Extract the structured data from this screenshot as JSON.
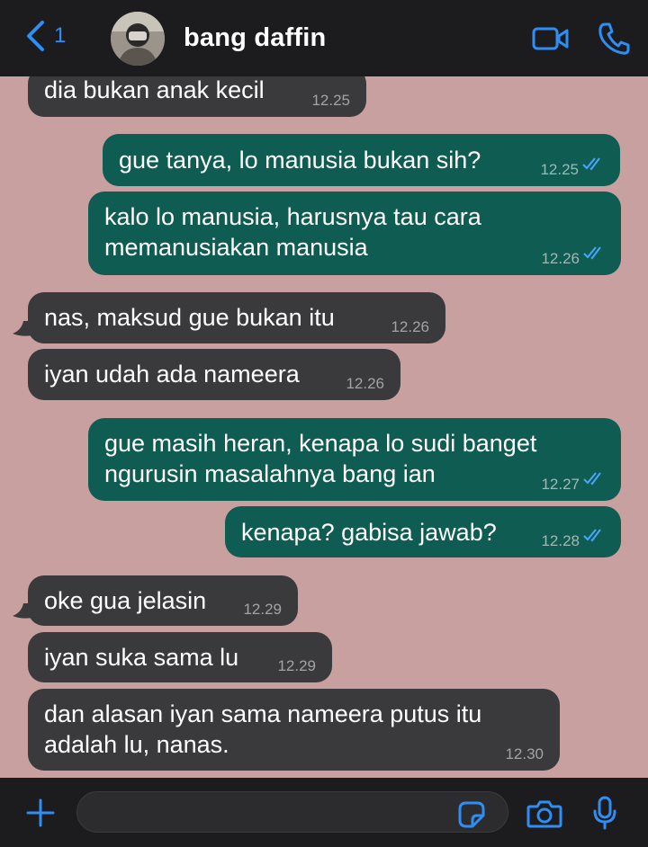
{
  "header": {
    "back_count": "1",
    "contact_name": "bang daffin",
    "icons": {
      "back": "chevron-left-icon",
      "video": "video-camera-icon",
      "call": "phone-icon"
    }
  },
  "colors": {
    "chat_background": "#c9a0a0",
    "incoming_bubble": "#3a3a3c",
    "outgoing_bubble": "#0f5c52",
    "accent": "#2f8ef4",
    "bar_background": "#1c1c1e"
  },
  "messages": [
    {
      "direction": "in",
      "text": "dia bukan anak kecil",
      "time": "12.25"
    },
    {
      "direction": "out",
      "text": "gue tanya, lo manusia bukan sih?",
      "time": "12.25",
      "read": true
    },
    {
      "direction": "out",
      "lines": [
        "kalo lo manusia, harusnya tau cara",
        "memanusiakan manusia"
      ],
      "time": "12.26",
      "read": true
    },
    {
      "direction": "in",
      "text": "nas, maksud gue bukan itu",
      "time": "12.26"
    },
    {
      "direction": "in",
      "text": "iyan udah ada nameera",
      "time": "12.26"
    },
    {
      "direction": "out",
      "lines": [
        "gue masih heran, kenapa lo sudi banget",
        "ngurusin masalahnya bang ian"
      ],
      "time": "12.27",
      "read": true
    },
    {
      "direction": "out",
      "text": "kenapa? gabisa jawab?",
      "time": "12.28",
      "read": true
    },
    {
      "direction": "in",
      "text": "oke gua jelasin",
      "time": "12.29"
    },
    {
      "direction": "in",
      "text": "iyan suka sama lu",
      "time": "12.29"
    },
    {
      "direction": "in",
      "lines": [
        "dan alasan iyan sama nameera putus itu",
        "adalah lu, nanas."
      ],
      "time": "12.30"
    }
  ],
  "input": {
    "value": "",
    "placeholder": ""
  },
  "bottom_icons": {
    "add": "plus-icon",
    "sticker": "sticker-icon",
    "camera": "camera-icon",
    "mic": "microphone-icon"
  }
}
